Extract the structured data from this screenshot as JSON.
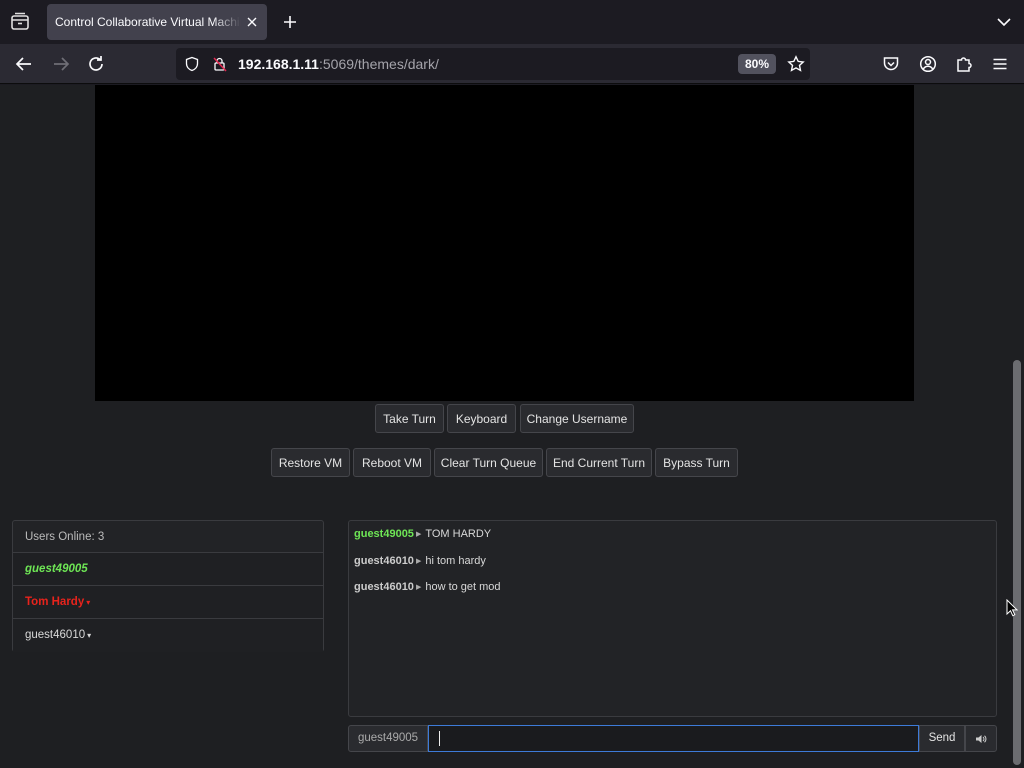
{
  "browser": {
    "tab_title": "Control Collaborative Virtual Machine",
    "url_host": "192.168.1.11",
    "url_rest": ":5069/themes/dark/",
    "zoom": "80%"
  },
  "controls": {
    "row1": [
      "Take Turn",
      "Keyboard",
      "Change Username"
    ],
    "row2": [
      "Restore VM",
      "Reboot VM",
      "Clear Turn Queue",
      "End Current Turn",
      "Bypass Turn"
    ]
  },
  "users": {
    "header": "Users Online: 3",
    "list": [
      {
        "name": "guest49005",
        "color": "#6ee655"
      },
      {
        "name": "Tom Hardy",
        "color": "#e8231c"
      },
      {
        "name": "guest46010",
        "color": "#d8d8d8"
      }
    ]
  },
  "chat": {
    "messages": [
      {
        "user": "guest49005",
        "user_color": "#6ee655",
        "text": "TOM HARDY"
      },
      {
        "user": "guest46010",
        "user_color": "#cccccc",
        "text": "hi tom hardy"
      },
      {
        "user": "guest46010",
        "user_color": "#cccccc",
        "text": "how to get mod"
      }
    ],
    "username": "guest49005",
    "input_value": "",
    "send_label": "Send"
  }
}
